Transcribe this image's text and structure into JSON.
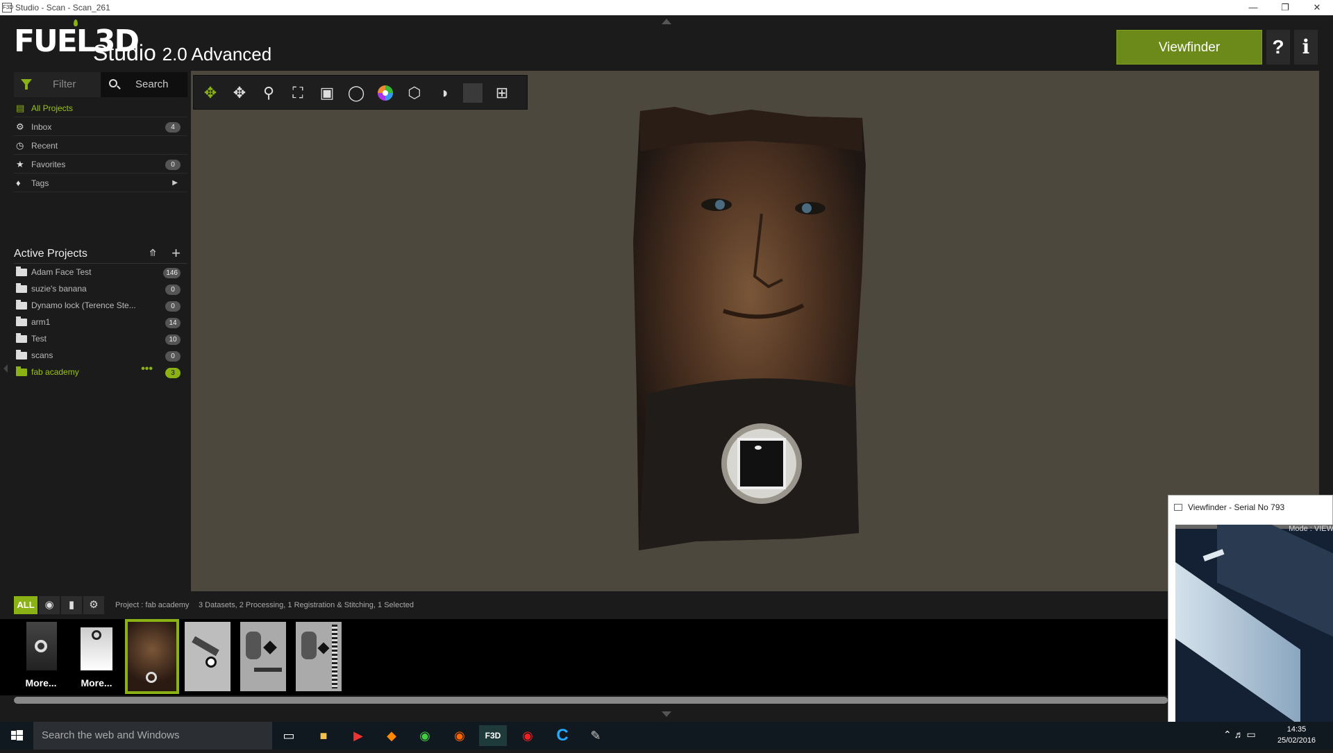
{
  "window": {
    "title": "Studio - Scan - Scan_261",
    "logo": "F3D"
  },
  "header": {
    "brand": "FUEL3D",
    "product": "Studio",
    "version": "2.0 Advanced",
    "viewfinder_label": "Viewfinder",
    "help_label": "?",
    "info_label": "i"
  },
  "sidebar": {
    "filter_label": "Filter",
    "search_label": "Search",
    "nav": [
      {
        "label": "All Projects",
        "icon": "folder-stack-icon",
        "selected": true
      },
      {
        "label": "Inbox",
        "icon": "gear-icon",
        "badge": "4"
      },
      {
        "label": "Recent",
        "icon": "clock-icon"
      },
      {
        "label": "Favorites",
        "icon": "star-icon",
        "badge": "0"
      },
      {
        "label": "Tags",
        "icon": "tag-icon"
      }
    ],
    "active_projects_title": "Active Projects",
    "projects": [
      {
        "label": "Adam Face Test",
        "count": "146"
      },
      {
        "label": "suzie's banana",
        "count": "0"
      },
      {
        "label": "Dynamo lock (Terence Ste...",
        "count": "0"
      },
      {
        "label": "arm1",
        "count": "14"
      },
      {
        "label": "Test",
        "count": "10"
      },
      {
        "label": "scans",
        "count": "0"
      },
      {
        "label": "fab academy",
        "count": "3",
        "selected": true,
        "more": "•••"
      }
    ]
  },
  "toolbar": {
    "tools": [
      "orbit-icon",
      "pan-icon",
      "zoom-icon",
      "fit-icon",
      "focus-icon",
      "light-icon",
      "color-wheel-icon",
      "cube-icon",
      "shading-icon",
      "background-icon",
      "crop-icon"
    ]
  },
  "statusbar": {
    "all_label": "ALL",
    "project": "Project : fab academy",
    "datasets": "3 Datasets, 2 Processing, 1 Registration & Stitching, 1 Selected"
  },
  "thumbnails": [
    {
      "caption": "More...",
      "kind": "dark-scan"
    },
    {
      "caption": "More...",
      "kind": "white-scan"
    },
    {
      "caption": "",
      "kind": "face",
      "selected": true
    },
    {
      "caption": "",
      "kind": "object"
    },
    {
      "caption": "",
      "kind": "object"
    },
    {
      "caption": "",
      "kind": "object"
    }
  ],
  "viewfinder": {
    "title": "Viewfinder - Serial No 793",
    "mode": "Mode : VIEW"
  },
  "taskbar": {
    "search_placeholder": "Search the web and Windows",
    "time": "14:35",
    "date": "25/02/2016"
  },
  "colors": {
    "accent": "#8bb214",
    "viewport": "#4d483e",
    "bg": "#1b1b1b"
  }
}
